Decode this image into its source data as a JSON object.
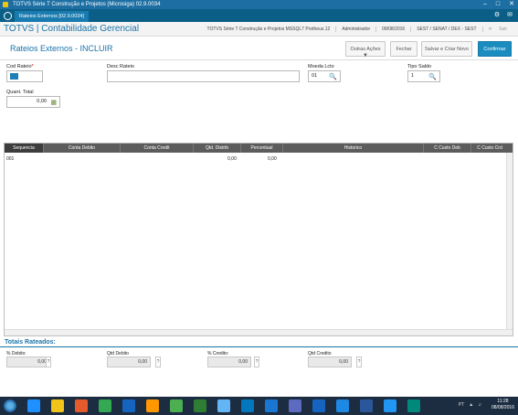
{
  "window": {
    "title": "TOTVS Série T Construção e Projetos (Microsiga) 02.9.0034"
  },
  "tabbar": {
    "tab_label": "Rateios Externos [02.9.0034]"
  },
  "header": {
    "brand": "TOTVS | Contabilidade Gerencial",
    "environment": "TOTVS Série T Construção e Projetos MSSQL7 Protheus.12",
    "user": "Administrador",
    "date": "08/08/2016",
    "branch": "SEST / SENAT / DEX - SEST",
    "exit_label": "Sair"
  },
  "page": {
    "title": "Rateios Externos - INCLUIR",
    "actions": {
      "other": "Outras Ações",
      "close": "Fechar",
      "save_new": "Salvar e Criar Novo",
      "confirm": "Confirmar"
    }
  },
  "form": {
    "cod_rateio_label": "Cod Rateio",
    "cod_rateio_required": "*",
    "desc_rateio_label": "Desc Rateio",
    "desc_rateio_value": "",
    "moeda_label": "Moeda Lcto",
    "moeda_value": "01",
    "tipo_saldo_label": "Tipo Saldo",
    "tipo_saldo_value": "1",
    "quant_total_label": "Quant. Total",
    "quant_total_value": "0,00"
  },
  "grid": {
    "columns": [
      "Sequencia",
      "Conta Debito",
      "Conta Credit",
      "Qtd. Distrib",
      "Percentual",
      "Historico",
      "C Custo Deb",
      "C Custo Crd"
    ],
    "rows": [
      {
        "sequencia": "001",
        "qtd": "0,00",
        "percentual": "0,00"
      }
    ]
  },
  "totals": {
    "title": "Totais Rateados:",
    "items": [
      {
        "label": "% Debito:",
        "value": "0,00"
      },
      {
        "label": "Qtd Debito",
        "value": "0,00"
      },
      {
        "label": "% Credito:",
        "value": "0,00"
      },
      {
        "label": "Qtd Credito",
        "value": "0,00"
      }
    ],
    "help": "?"
  },
  "taskbar": {
    "lang": "PT",
    "time": "11:28",
    "date": "08/08/2016",
    "app_colors": [
      "#1e90ff",
      "#f0c419",
      "#e45a2b",
      "#34a853",
      "#1565c0",
      "#ff9800",
      "#4caf50",
      "#2e7d32",
      "#64b5f6",
      "#0277bd",
      "#1976d2",
      "#5c6bc0",
      "#1565c0",
      "#1e88e5",
      "#2b579a",
      "#2196f3",
      "#00897b"
    ]
  }
}
